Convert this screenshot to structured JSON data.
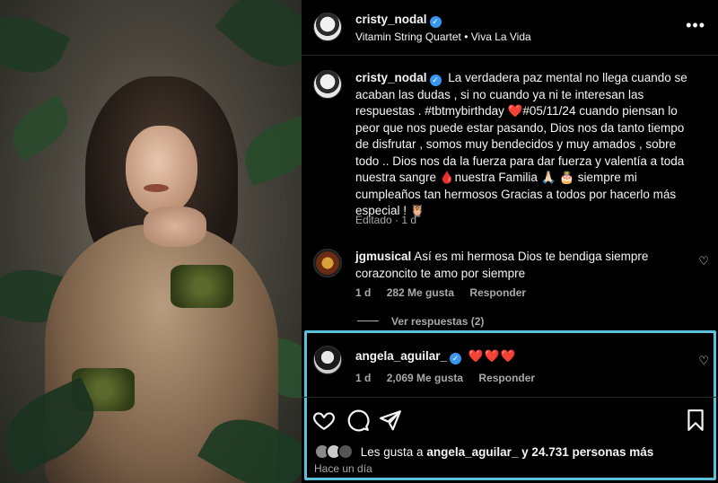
{
  "post": {
    "author": "cristy_nodal",
    "music_artist": "Vitamin String Quartet",
    "music_separator": "•",
    "music_title": "Viva La Vida",
    "more_label": "•••"
  },
  "caption": {
    "author": "cristy_nodal",
    "text": "La verdadera paz mental no llega cuando se acaban las dudas , si no cuando ya ni te interesan las respuestas . #tbtmybirthday ❤️#05/11/24 cuando piensan lo peor que nos puede estar pasando, Dios nos da tanto tiempo de disfrutar , somos muy bendecidos y muy amados , sobre todo .. Dios nos da la fuerza para dar fuerza y valentía a toda nuestra sangre 🩸nuestra Familia 🙏🏻 🎂 siempre mi cumpleaños tan hermosos Gracias a todos por hacerlo más especial ! 🦉",
    "meta": "Editado · 1 d"
  },
  "comments": [
    {
      "author": "jgmusical",
      "text": "Así es mi hermosa Dios te bendiga siempre corazoncito te amo por siempre",
      "time": "1 d",
      "likes": "282 Me gusta",
      "reply": "Responder",
      "view_replies": "Ver respuestas (2)"
    },
    {
      "author": "angela_aguilar_",
      "text": "❤️❤️❤️",
      "time": "1 d",
      "likes": "2,069 Me gusta",
      "reply": "Responder"
    }
  ],
  "likes_summary": {
    "prefix": "Les gusta a",
    "user": "angela_aguilar_",
    "suffix": "y 24.731 personas más"
  },
  "time_ago": "Hace un día",
  "colors": {
    "highlight": "#5bc0de",
    "verified": "#3897f0",
    "heart": "#ed4956"
  }
}
